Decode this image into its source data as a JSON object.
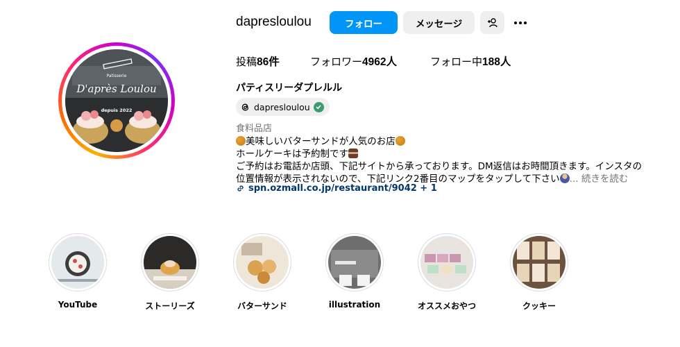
{
  "profile": {
    "username": "dapresloulou",
    "follow_label": "フォロー",
    "message_label": "メッセージ",
    "stats": {
      "posts_label": "投稿",
      "posts_count": "86件",
      "followers_label": "フォロワー",
      "followers_count": "4962人",
      "following_label": "フォロー中",
      "following_count": "188人"
    },
    "full_name": "パティスリーダプレルル",
    "threads_handle": "dapresloulou",
    "category": "食料品店",
    "bio": {
      "line1": "美味しいバターサンドが人気のお店",
      "line2": "ホールケーキは予約制です",
      "line3": "ご予約はお電話か店頭、下記サイトから承っております。DM返信はお時間頂きます。インスタの",
      "line4": "位置情報が表示されないので、下記リンク2番目のマップをタップして下さい",
      "more": "... 続きを読む"
    },
    "link": "spn.ozmall.co.jp/restaurant/9042 + 1",
    "avatar_text": {
      "brand": "Patisserie",
      "name": "D'après Loulou",
      "since": "depuis 2022"
    }
  },
  "highlights": [
    {
      "label": "YouTube"
    },
    {
      "label": "ストーリーズ"
    },
    {
      "label": "バターサンド"
    },
    {
      "label": "illustration"
    },
    {
      "label": "オススメおやつ"
    },
    {
      "label": "クッキー"
    }
  ],
  "colors": {
    "follow_button": "#0095f6",
    "secondary_button": "#efefef",
    "link": "#00376b",
    "muted_text": "#737373"
  }
}
